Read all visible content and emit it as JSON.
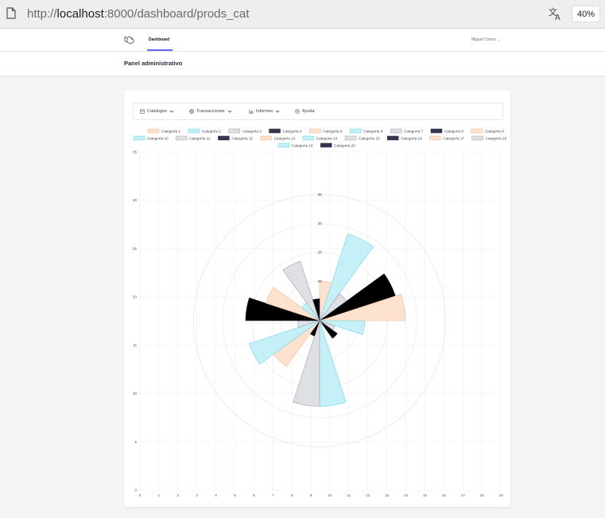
{
  "browser": {
    "url_prefix": "http://",
    "url_host": "localhost",
    "url_rest": ":8000/dashboard/prods_cat",
    "zoom": "40%"
  },
  "nav": {
    "dashboard_label": "Dashboard",
    "user_name": "Miguel Cortez",
    "user_chevron": "⌄"
  },
  "header": {
    "title": "Panel administrativo"
  },
  "menu": [
    {
      "label": "Catálogos",
      "icon": "box-icon"
    },
    {
      "label": "Transacciones",
      "icon": "globe-icon"
    },
    {
      "label": "Informes",
      "icon": "bar-chart-icon"
    },
    {
      "label": "Ayuda",
      "icon": "help-icon"
    }
  ],
  "chart_data": {
    "type": "polarArea",
    "categories": [
      "Categoría 1",
      "Categoría 2",
      "Categoría 3",
      "Categoría 4",
      "Categoría 5",
      "Categoría 6",
      "Categoría 7",
      "Categoría 8",
      "Categoría 9",
      "Categoría 10",
      "Categoría 11",
      "Categoría 12",
      "Categoría 13",
      "Categoría 14",
      "Categoría 15",
      "Categoría 16",
      "Categoría 17",
      "Categoría 18",
      "Categoría 19",
      "Categoría 20"
    ],
    "values": [
      20,
      29,
      19,
      27,
      28,
      21,
      16,
      17,
      14,
      28,
      28,
      16,
      23,
      26,
      17,
      26,
      23,
      17,
      24,
      17
    ],
    "colors": [
      "#fde2cf",
      "#c5f0f7",
      "#dfe0e4",
      "#000000",
      "#fde2cf",
      "#c5f0f7",
      "#dfe0e4",
      "#000000",
      "#fde2cf",
      "#c5f0f7",
      "#dfe0e4",
      "#000000",
      "#fde2cf",
      "#c5f0f7",
      "#dfe0e4",
      "#000000",
      "#fde2cf",
      "#c5f0f7",
      "#dfe0e4",
      "#000000"
    ],
    "legend_colors": [
      "#fde2cf",
      "#c5f0f7",
      "#dfe0e4",
      "#33364d",
      "#fde2cf",
      "#c5f0f7",
      "#dfe0e4",
      "#33364d",
      "#fde2cf",
      "#c5f0f7",
      "#dfe0e4",
      "#33364d",
      "#fde2cf",
      "#c5f0f7",
      "#dfe0e4",
      "#33364d",
      "#fde2cf",
      "#c5f0f7",
      "#dfe0e4",
      "#33364d"
    ],
    "border_colors": [
      "#f3b48a",
      "#6fd3e4",
      "#9ca3af",
      "#33364d",
      "#f3b48a",
      "#6fd3e4",
      "#9ca3af",
      "#33364d",
      "#f3b48a",
      "#6fd3e4",
      "#9ca3af",
      "#33364d",
      "#f3b48a",
      "#6fd3e4",
      "#9ca3af",
      "#33364d",
      "#f3b48a",
      "#6fd3e4",
      "#9ca3af",
      "#33364d"
    ],
    "r_ticks": [
      20,
      25,
      30,
      35
    ],
    "r_range": [
      13.2,
      35
    ],
    "x_ticks": [
      "0",
      "1",
      "2",
      "3",
      "4",
      "5",
      "6",
      "7",
      "8",
      "9",
      "10",
      "11",
      "12",
      "13",
      "14",
      "15",
      "16",
      "17",
      "18",
      "19"
    ],
    "y_ticks": [
      "0",
      "5",
      "10",
      "15",
      "20",
      "25",
      "30",
      "35"
    ],
    "ylim": [
      0,
      35
    ],
    "legend_position": "top",
    "grid": true
  }
}
